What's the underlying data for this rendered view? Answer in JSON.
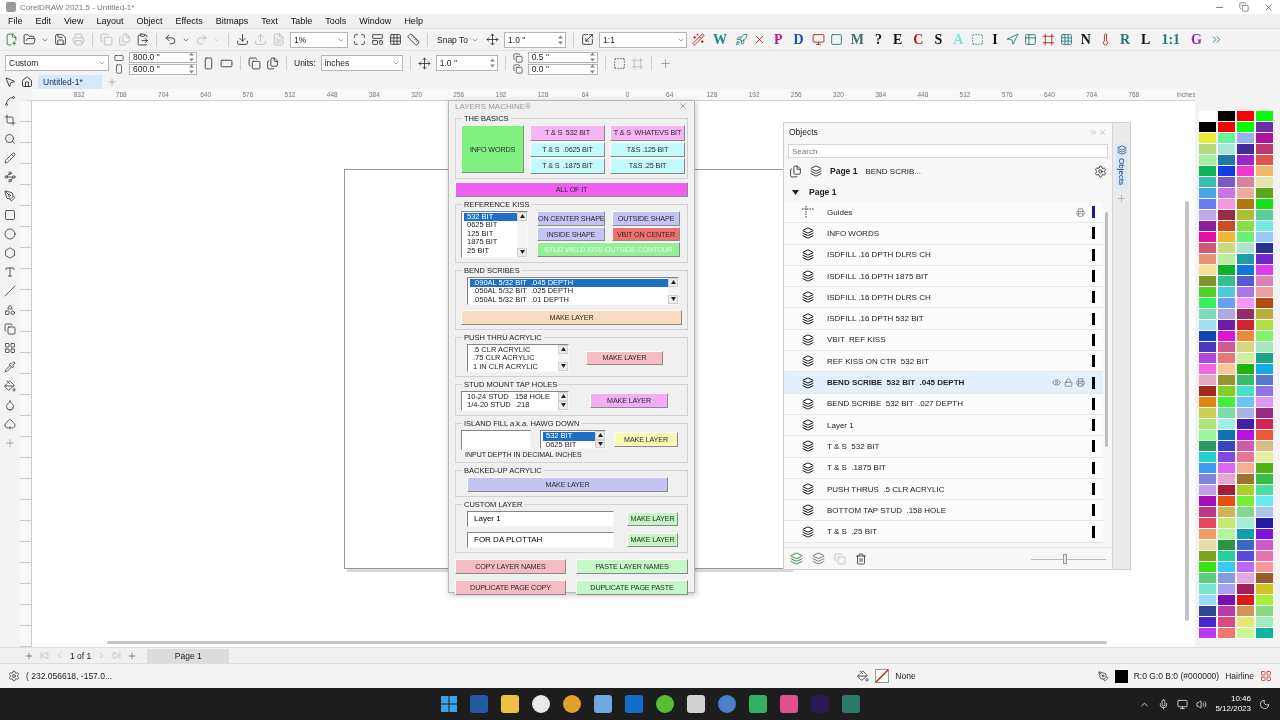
{
  "window": {
    "title": "CorelDRAW 2021.5 - Untitled-1*"
  },
  "menu": [
    "File",
    "Edit",
    "View",
    "Layout",
    "Object",
    "Effects",
    "Bitmaps",
    "Text",
    "Table",
    "Tools",
    "Window",
    "Help"
  ],
  "toolbar": {
    "zoom": "1%",
    "snap": "Snap To",
    "nudge": "1.0 \"",
    "scale": "1:1",
    "macros": [
      {
        "label": "W",
        "color": "#1f8a8a"
      },
      {
        "label": "P",
        "color": "#c2187a"
      },
      {
        "label": "D",
        "color": "#1e4fa0"
      },
      {
        "label": "M",
        "color": "#3d7070"
      },
      {
        "label": "?",
        "color": "#111111"
      },
      {
        "label": "E",
        "color": "#111111"
      },
      {
        "label": "C",
        "color": "#b01c1c"
      },
      {
        "label": "S",
        "color": "#111111"
      },
      {
        "label": "A",
        "color": "#7fe6e6"
      },
      {
        "label": "I",
        "color": "#111111"
      },
      {
        "label": "N",
        "color": "#111111"
      },
      {
        "label": "R",
        "color": "#1f7a7a"
      },
      {
        "label": "L",
        "color": "#111111"
      },
      {
        "label": "1:1",
        "color": "#1f7a7a"
      },
      {
        "label": "G",
        "color": "#a020c0"
      }
    ]
  },
  "property_bar": {
    "preset": "Custom",
    "width": "800.0 \"",
    "height": "600.0 \"",
    "units_label": "Units:",
    "units": "inches",
    "nudge": "1.0 \"",
    "dup_x": "0.5 \"",
    "dup_y": "0.0 \""
  },
  "doc_tabs": [
    {
      "label": "Untitled-1*",
      "selected": true
    }
  ],
  "ruler": {
    "labels": [
      "832",
      "768",
      "704",
      "640",
      "576",
      "512",
      "448",
      "384",
      "320",
      "256",
      "192",
      "128",
      "64",
      "0",
      "64",
      "128",
      "192",
      "256",
      "320",
      "384",
      "448",
      "512",
      "576",
      "640",
      "704",
      "768"
    ],
    "unit": "inches"
  },
  "layers_machine": {
    "title": "LAYERS MACHINE®",
    "basics": {
      "title": "THE BASICS",
      "main": {
        "label": "INFO WORDS",
        "color": "#80f080"
      },
      "buttons": [
        {
          "label": "T & S  532 BIT",
          "color": "#f6b4f6"
        },
        {
          "label": "T & S  WHATEVS BIT",
          "color": "#f6b4f6"
        },
        {
          "label": "T & S  .0625 BIT",
          "color": "#c4fafa"
        },
        {
          "label": "T&S .125 BIT",
          "color": "#c4fafa"
        },
        {
          "label": "T & S  .1875 BIT",
          "color": "#c4fafa"
        },
        {
          "label": "T&S .25 BIT",
          "color": "#c4fafa"
        }
      ],
      "all": {
        "label": "ALL OF IT",
        "color": "#f060f0"
      }
    },
    "reference_kiss": {
      "title": "REFERENCE KISS",
      "list": [
        {
          "label": "532 BIT",
          "selected": true
        },
        {
          "label": "0625 BIT",
          "selected": false
        },
        {
          "label": "125 BIT",
          "selected": false
        },
        {
          "label": "1875 BIT",
          "selected": false
        },
        {
          "label": "25 BIT",
          "selected": false
        }
      ],
      "buttons": [
        {
          "label": "ON CENTER SHAPE",
          "color": "#c4c4f4",
          "disabled": false
        },
        {
          "label": "OUTSIDE SHAPE",
          "color": "#c4c4f4",
          "disabled": false
        },
        {
          "label": "INSIDE SHAPE",
          "color": "#c4c4f4",
          "disabled": false
        },
        {
          "label": "VBIT ON CENTER",
          "color": "#f07070",
          "disabled": false
        },
        {
          "label": "STUD WELD KISS OUTSIDE CONTOUR",
          "color": "#94f094",
          "disabled": true
        }
      ]
    },
    "bend_scribes": {
      "title": "BEND SCRIBES",
      "list": [
        {
          "label": ".090AL 5/32 BIT  .045 DEPTH",
          "selected": true
        },
        {
          "label": ".050AL 5/32 BIT  .025 DEPTH",
          "selected": false
        },
        {
          "label": ".050AL 5/32 BIT  .01 DEPTH",
          "selected": false
        }
      ],
      "button": {
        "label": "MAKE LAYER",
        "color": "#f8dcc0"
      }
    },
    "push_thru": {
      "title": "PUSH THRU ACRYLIC",
      "list": [
        {
          "label": ".5 CLR ACRYLIC",
          "selected": false
        },
        {
          "label": ".75 CLR ACRYLIC",
          "selected": false
        },
        {
          "label": "1 IN CLR ACRYLIC",
          "selected": false
        }
      ],
      "button": {
        "label": "MAKE LAYER",
        "color": "#f4bcc4"
      }
    },
    "stud_mount": {
      "title": "STUD MOUNT TAP HOLES",
      "list": [
        {
          "label": "10-24 STUD  .158 HOLE",
          "selected": false
        },
        {
          "label": "1/4-20 STUD  .218",
          "selected": false
        }
      ],
      "button": {
        "label": "MAKE LAYER",
        "color": "#f4acf4"
      }
    },
    "island_fill": {
      "title": "ISLAND FILL a.k.a. HAWG DOWN",
      "list": [
        {
          "label": "532 BIT",
          "selected": true
        },
        {
          "label": "0625 BIT",
          "selected": false
        }
      ],
      "note": "INPUT DEPTH IN DECIMAL INCHES",
      "button": {
        "label": "MAKE LAYER",
        "color": "#f8f8b4"
      }
    },
    "backed_up": {
      "title": "BACKED-UP ACRYLIC",
      "button": {
        "label": "MAKE LAYER",
        "color": "#c4c4f4"
      }
    },
    "custom_layer": {
      "title": "CUSTOM LAYER",
      "rows": [
        {
          "value": "Layer 1",
          "button": {
            "label": "MAKE LAYER",
            "color": "#c4f6c4"
          }
        },
        {
          "value": "FOR DA PLOTTAH",
          "button": {
            "label": "MAKE LAYER",
            "color": "#c4f6c4"
          }
        }
      ]
    },
    "actions": [
      {
        "label": "COPY LAYER NAMES",
        "color": "#f4bcc4"
      },
      {
        "label": "PASTE LAYER NAMES",
        "color": "#c4f8c4"
      },
      {
        "label": "DUPLICATE PAGE COPY",
        "color": "#f4bcc4"
      },
      {
        "label": "DUPLICATE PAGE PASTE",
        "color": "#c4f8c4"
      }
    ]
  },
  "objects_panel": {
    "title": "Objects",
    "search": {
      "placeholder": "Search"
    },
    "page": "Page 1",
    "crumb": "BEND SCRIB...",
    "side_tab": "Objects",
    "zoom": {
      "level": 0.45
    },
    "tree": [
      {
        "label": "Page 1",
        "expanded": true,
        "children": [
          {
            "label": "Guides",
            "kind": "guides",
            "selected": false,
            "color": "#1a1a8c"
          },
          {
            "label": "INFO WORDS",
            "kind": "layer",
            "selected": false,
            "color": "#000000"
          },
          {
            "label": "ISDFILL .16 DPTH DLRS CH",
            "kind": "layer",
            "selected": false,
            "color": "#000000"
          },
          {
            "label": "ISDFILL .16 DPTH 1875 BIT",
            "kind": "layer",
            "selected": false,
            "color": "#000000"
          },
          {
            "label": "ISDFILL .16 DPTH DLRS CH",
            "kind": "layer",
            "selected": false,
            "color": "#000000"
          },
          {
            "label": "ISDFILL .16 DPTH 532 BIT",
            "kind": "layer",
            "selected": false,
            "color": "#000000"
          },
          {
            "label": "VBIT  REF KISS",
            "kind": "layer",
            "selected": false,
            "color": "#000000"
          },
          {
            "label": "REF KISS ON CTR  532 BIT",
            "kind": "layer",
            "selected": false,
            "color": "#000000"
          },
          {
            "label": "BEND SCRIBE  532 BIT  .045 DEPTH",
            "kind": "layer",
            "selected": true,
            "color": "#000000"
          },
          {
            "label": "BEND SCRIBE  532 BIT  .027 DEPTH",
            "kind": "layer",
            "selected": false,
            "color": "#000000"
          },
          {
            "label": "Layer 1",
            "kind": "layer",
            "selected": false,
            "color": "#000000"
          },
          {
            "label": "T & S  532 BIT",
            "kind": "layer",
            "selected": false,
            "color": "#000000"
          },
          {
            "label": "T & S  .1875 BIT",
            "kind": "layer",
            "selected": false,
            "color": "#000000"
          },
          {
            "label": "PUSH THRUS  .5 CLR ACRYLIC",
            "kind": "layer",
            "selected": false,
            "color": "#000000"
          },
          {
            "label": "BOTTOM TAP STUD  .158 HOLE",
            "kind": "layer",
            "selected": false,
            "color": "#000000"
          },
          {
            "label": "T & S  .25 BIT",
            "kind": "layer",
            "selected": false,
            "color": "#000000"
          }
        ]
      }
    ]
  },
  "page_nav": {
    "count": "1 of 1",
    "tabs": [
      {
        "label": "Page 1",
        "selected": true
      }
    ]
  },
  "status_bar": {
    "coords": "( 232.056618, -157.0...",
    "fill": "None",
    "outline": "R:0 G:0 B:0 (#000000)",
    "outline_width": "Hairline"
  },
  "taskbar": {
    "time": "10:46",
    "date": "5/12/2023"
  }
}
